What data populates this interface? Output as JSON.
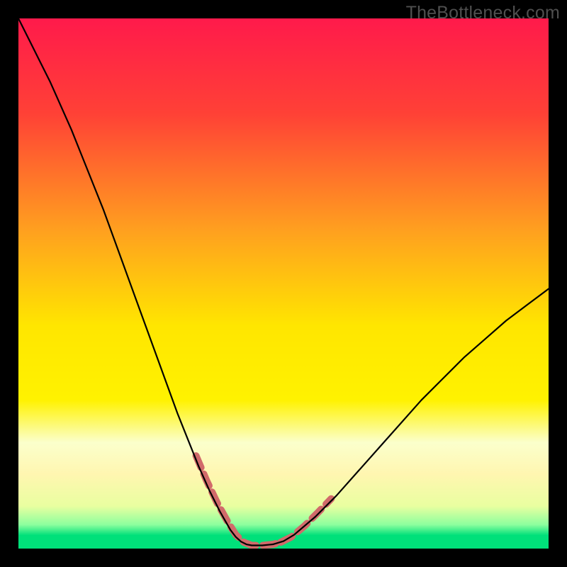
{
  "watermark": "TheBottleneck.com",
  "chart_data": {
    "type": "line",
    "title": "",
    "xlabel": "",
    "ylabel": "",
    "xlim": [
      0,
      100
    ],
    "ylim": [
      0,
      100
    ],
    "gradient_stops": [
      {
        "offset": 0.0,
        "color": "#ff1a4b"
      },
      {
        "offset": 0.18,
        "color": "#ff4136"
      },
      {
        "offset": 0.4,
        "color": "#ffa01f"
      },
      {
        "offset": 0.58,
        "color": "#ffe600"
      },
      {
        "offset": 0.72,
        "color": "#fff200"
      },
      {
        "offset": 0.8,
        "color": "#fbffcc"
      },
      {
        "offset": 0.86,
        "color": "#fff6b0"
      },
      {
        "offset": 0.92,
        "color": "#e9ffa0"
      },
      {
        "offset": 0.955,
        "color": "#8cff9e"
      },
      {
        "offset": 0.975,
        "color": "#00e07a"
      },
      {
        "offset": 1.0,
        "color": "#00e07a"
      }
    ],
    "series": [
      {
        "name": "bottleneck-curve",
        "color": "#000000",
        "width": 2.2,
        "x": [
          0,
          2,
          4,
          6,
          8,
          10,
          12,
          14,
          16,
          18,
          20,
          22,
          24,
          26,
          28,
          30,
          32,
          34,
          36,
          38,
          40,
          41,
          42,
          43,
          44,
          46,
          48,
          50,
          52,
          56,
          60,
          64,
          68,
          72,
          76,
          80,
          84,
          88,
          92,
          96,
          100
        ],
        "y": [
          100,
          96,
          92,
          88,
          83.5,
          79,
          74,
          69,
          64,
          58.5,
          53,
          47.5,
          42,
          36.5,
          31,
          25.5,
          20.5,
          15.5,
          11,
          7,
          3.5,
          2.2,
          1.3,
          0.8,
          0.6,
          0.6,
          0.8,
          1.4,
          2.6,
          6,
          10,
          14.5,
          19,
          23.5,
          28,
          32,
          36,
          39.5,
          43,
          46,
          49
        ]
      }
    ],
    "highlight_segments": [
      {
        "name": "left-threshold",
        "color": "#d16a6a",
        "width": 10,
        "dash": [
          18,
          10
        ],
        "x": [
          33.5,
          35.5,
          37.5,
          39.5,
          41.0,
          42.5
        ],
        "y": [
          17.5,
          12.8,
          8.6,
          5.0,
          2.6,
          1.2
        ]
      },
      {
        "name": "bottom-flat",
        "color": "#d16a6a",
        "width": 10,
        "dash": [
          18,
          10
        ],
        "x": [
          42.5,
          44.0,
          46.0,
          48.0,
          49.5
        ],
        "y": [
          1.2,
          0.6,
          0.6,
          0.8,
          1.2
        ]
      },
      {
        "name": "right-threshold",
        "color": "#d16a6a",
        "width": 10,
        "dash": [
          18,
          10
        ],
        "x": [
          49.5,
          51.5,
          54.0,
          56.5,
          59.0
        ],
        "y": [
          1.2,
          2.2,
          4.3,
          6.8,
          9.4
        ]
      }
    ]
  }
}
